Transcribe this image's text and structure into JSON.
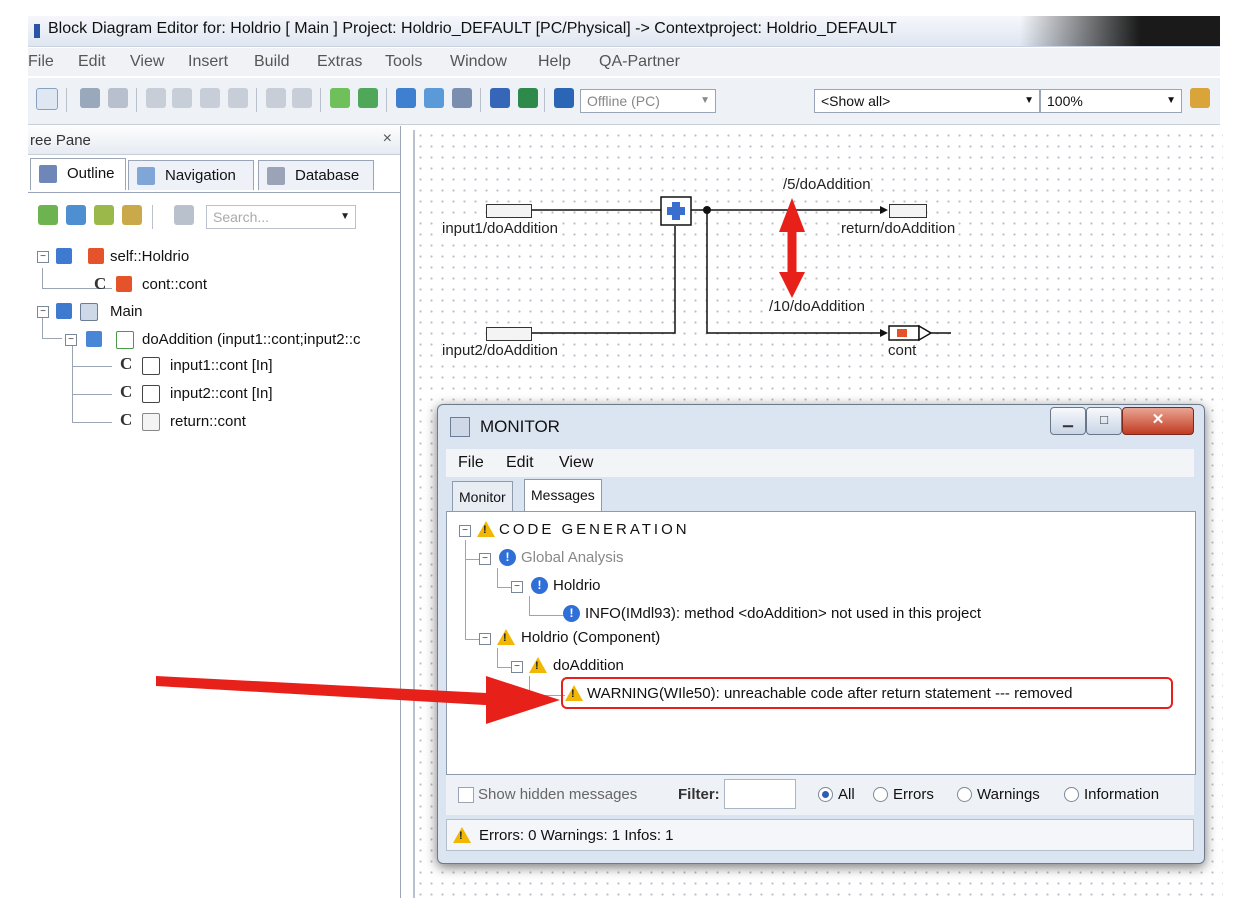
{
  "window": {
    "title": "Block Diagram Editor for: Holdrio [ Main ] Project: Holdrio_DEFAULT [PC/Physical] -> Contextproject: Holdrio_DEFAULT"
  },
  "menubar": [
    "File",
    "Edit",
    "View",
    "Insert",
    "Build",
    "Extras",
    "Tools",
    "Window",
    "Help",
    "QA-Partner"
  ],
  "toolbar": {
    "mode_select": "Offline (PC)",
    "filter_select": "<Show all>",
    "zoom_select": "100%"
  },
  "tree_pane": {
    "title": "ree Pane",
    "close": "×",
    "tabs": [
      "Outline",
      "Navigation",
      "Database"
    ],
    "search_placeholder": "Search...",
    "items": [
      "self::Holdrio",
      "cont::cont",
      "Main",
      "doAddition (input1::cont;input2::c",
      "input1::cont [In]",
      "input2::cont [In]",
      "return::cont"
    ]
  },
  "diagram": {
    "labels": {
      "input1": "input1/doAddition",
      "input2": "input2/doAddition",
      "ret": "return/doAddition",
      "cont": "cont",
      "l5": "/5/doAddition",
      "l10": "/10/doAddition"
    }
  },
  "monitor": {
    "title": "MONITOR",
    "menu": [
      "File",
      "Edit",
      "View"
    ],
    "tabs": [
      "Monitor",
      "Messages"
    ],
    "tree": {
      "root": "CODE GENERATION",
      "global": "Global Analysis",
      "holdrio": "Holdrio",
      "info": "INFO(IMdl93): method <doAddition> not used in this project",
      "component": "Holdrio (Component)",
      "method": "doAddition",
      "warning": "WARNING(WIle50): unreachable code after return statement --- removed"
    },
    "filter": {
      "show_hidden": "Show hidden messages",
      "filter_label": "Filter:",
      "options": [
        "All",
        "Errors",
        "Warnings",
        "Information"
      ],
      "selected": "All"
    },
    "status": "Errors: 0  Warnings: 1  Infos: 1"
  },
  "colors": {
    "annotation_red": "#e8201a",
    "warning_yellow": "#f2b705",
    "info_blue": "#2f6fd8"
  }
}
